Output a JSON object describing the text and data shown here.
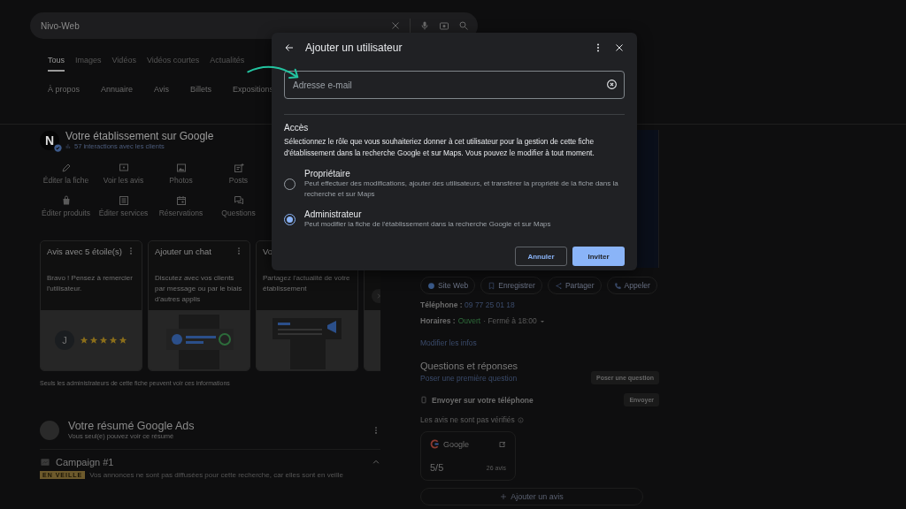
{
  "search": {
    "value": "Nivo-Web"
  },
  "tabs": [
    {
      "label": "Tous",
      "selected": true
    },
    {
      "label": "Images",
      "selected": false
    },
    {
      "label": "Vidéos",
      "selected": false
    },
    {
      "label": "Vidéos courtes",
      "selected": false
    },
    {
      "label": "Actualités",
      "selected": false
    }
  ],
  "chips": [
    "À propos",
    "Annuaire",
    "Avis",
    "Billets",
    "Expositions"
  ],
  "business": {
    "avatar_letter": "N",
    "title": "Votre établissement sur Google",
    "interactions": "57 interactions avec les clients",
    "actions": [
      {
        "kind": "edit",
        "label": "Éditer la fiche"
      },
      {
        "kind": "reviews",
        "label": "Voir les avis"
      },
      {
        "kind": "photos",
        "label": "Photos"
      },
      {
        "kind": "posts",
        "label": "Posts"
      },
      {
        "kind": "products",
        "label": "Éditer produits"
      },
      {
        "kind": "services",
        "label": "Éditer services"
      },
      {
        "kind": "bookings",
        "label": "Réservations"
      },
      {
        "kind": "questions",
        "label": "Questions"
      }
    ],
    "cards": [
      {
        "kind": "review",
        "title": "Avis avec 5 étoile(s)",
        "text": "Bravo ! Pensez à remercier l'utilisateur.",
        "avatar_letter": "J",
        "stars": 5
      },
      {
        "kind": "chat",
        "title": "Ajouter un chat",
        "text": "Discutez avec vos clients par message ou par le biais d'autres applis"
      },
      {
        "kind": "post",
        "title": "Vo",
        "text": "Partagez l'actualité de votre établissement"
      }
    ],
    "note": "Seuls les administrateurs de cette fiche peuvent voir ces informations"
  },
  "ads": {
    "title": "Votre résumé Google Ads",
    "subtitle": "Vous seul(e) pouvez voir ce résumé",
    "campaign": {
      "name": "Campaign #1",
      "badge": "EN VEILLE",
      "text": "Vos annonces ne sont pas diffusées pour cette recherche, car elles sont en veille",
      "expanded": true
    }
  },
  "place": {
    "buttons": [
      {
        "kind": "web",
        "label": "Site Web"
      },
      {
        "kind": "save",
        "label": "Enregistrer"
      },
      {
        "kind": "share",
        "label": "Partager"
      },
      {
        "kind": "call",
        "label": "Appeler"
      }
    ],
    "phone": {
      "label": "Téléphone :",
      "value": "09 77 25 01 18"
    },
    "hours": {
      "label": "Horaires :",
      "status": "Ouvert",
      "detail": "· Fermé à 18:00"
    },
    "edit_link": "Modifier les infos",
    "qa": {
      "title": "Questions et réponses",
      "link": "Poser une première question",
      "button": "Poser une question"
    },
    "send": {
      "text": "Envoyer sur votre téléphone",
      "button": "Envoyer"
    },
    "reviews_note": "Les avis ne sont pas vérifiés",
    "review_source": {
      "name": "Google",
      "score": "5/5",
      "count": "26 avis"
    },
    "add_review": "Ajouter un avis"
  },
  "dialog": {
    "title": "Ajouter un utilisateur",
    "field": {
      "placeholder": "Adresse e-mail"
    },
    "section": "Accès",
    "description": "Sélectionnez le rôle que vous souhaiteriez donner à cet utilisateur pour la gestion de cette fiche d'établissement dans la recherche Google et sur Maps. Vous pouvez le modifier à tout moment.",
    "roles": [
      {
        "name": "Propriétaire",
        "description": "Peut effectuer des modifications, ajouter des utilisateurs, et transférer la propriété de la fiche dans la recherche et sur Maps",
        "selected": false
      },
      {
        "name": "Administrateur",
        "description": "Peut modifier la fiche de l'établissement dans la recherche Google et sur Maps",
        "selected": true
      }
    ],
    "cancel": "Annuler",
    "confirm": "Inviter"
  }
}
